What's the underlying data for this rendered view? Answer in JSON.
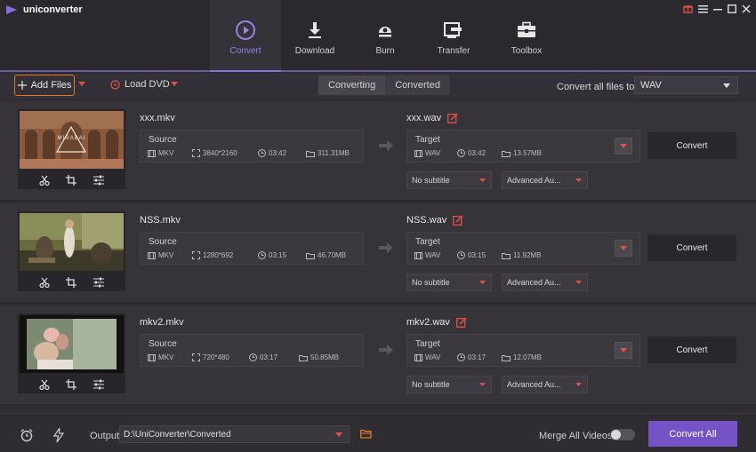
{
  "app": {
    "title": "uniconverter"
  },
  "nav": {
    "tabs": [
      {
        "label": "Convert",
        "icon": "convert-icon",
        "active": true
      },
      {
        "label": "Download",
        "icon": "download-icon",
        "active": false
      },
      {
        "label": "Burn",
        "icon": "burn-icon",
        "active": false
      },
      {
        "label": "Transfer",
        "icon": "transfer-icon",
        "active": false
      },
      {
        "label": "Toolbox",
        "icon": "toolbox-icon",
        "active": false
      }
    ]
  },
  "toolbar": {
    "add_files": "Add Files",
    "load_dvd": "Load DVD",
    "segments": [
      "Converting",
      "Converted"
    ],
    "convert_all_to": "Convert all files to:",
    "format": "WAV"
  },
  "files": [
    {
      "name": "xxx.mkv",
      "source_label": "Source",
      "src_format": "MKV",
      "src_resolution": "3840*2160",
      "src_duration": "03:42",
      "src_size": "311.31MB",
      "target_name": "xxx.wav",
      "target_label": "Target",
      "tgt_format": "WAV",
      "tgt_duration": "03:42",
      "tgt_size": "13.57MB",
      "subtitle": "No subtitle",
      "audio": "Advanced Au...",
      "convert": "Convert",
      "thumb_caption": "MIRABAI"
    },
    {
      "name": "NSS.mkv",
      "source_label": "Source",
      "src_format": "MKV",
      "src_resolution": "1280*692",
      "src_duration": "03:15",
      "src_size": "46.70MB",
      "target_name": "NSS.wav",
      "target_label": "Target",
      "tgt_format": "WAV",
      "tgt_duration": "03:15",
      "tgt_size": "11.92MB",
      "subtitle": "No subtitle",
      "audio": "Advanced Au...",
      "convert": "Convert"
    },
    {
      "name": "mkv2.mkv",
      "source_label": "Source",
      "src_format": "MKV",
      "src_resolution": "720*480",
      "src_duration": "03:17",
      "src_size": "50.85MB",
      "target_name": "mkv2.wav",
      "target_label": "Target",
      "tgt_format": "WAV",
      "tgt_duration": "03:17",
      "tgt_size": "12.07MB",
      "subtitle": "No subtitle",
      "audio": "Advanced Au...",
      "convert": "Convert"
    }
  ],
  "bottom": {
    "output_label": "Output",
    "output_path": "D:\\UniConverter\\Converted",
    "merge_label": "Merge All Videos",
    "merge_enabled": false,
    "convert_all": "Convert All"
  },
  "colors": {
    "accent": "#7652c7",
    "highlight": "#e07a2b",
    "edit": "#e0504a"
  }
}
